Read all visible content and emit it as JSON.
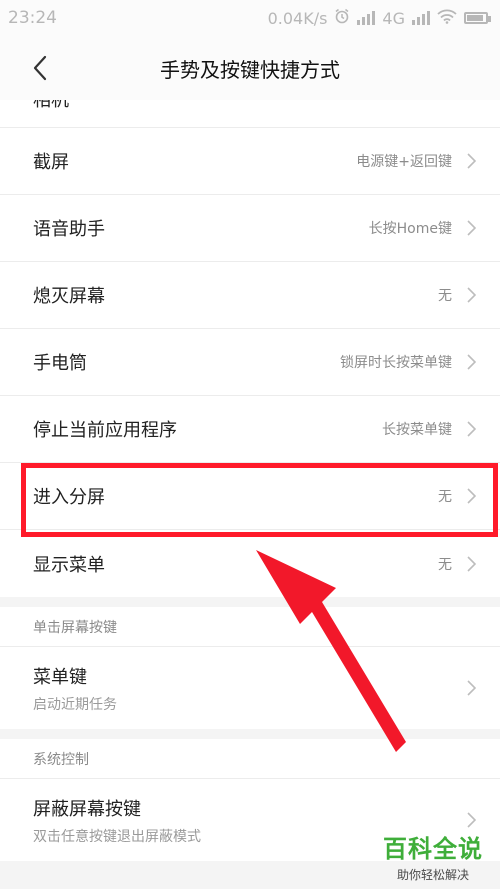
{
  "status_bar": {
    "time": "23:24",
    "speed": "0.04K/s",
    "network": "4G"
  },
  "header": {
    "title": "手势及按键快捷方式"
  },
  "gesture_rows": [
    {
      "label": "截屏",
      "value": "电源键+返回键"
    },
    {
      "label": "语音助手",
      "value": "长按Home键"
    },
    {
      "label": "熄灭屏幕",
      "value": "无"
    },
    {
      "label": "手电筒",
      "value": "锁屏时长按菜单键"
    },
    {
      "label": "停止当前应用程序",
      "value": "长按菜单键"
    },
    {
      "label": "进入分屏",
      "value": "无"
    },
    {
      "label": "显示菜单",
      "value": "无"
    }
  ],
  "partial_row_label": "相机",
  "section_single_tap": {
    "header": "单击屏幕按键",
    "row": {
      "label": "菜单键",
      "sub": "启动近期任务"
    }
  },
  "section_system": {
    "header": "系统控制",
    "row": {
      "label": "屏蔽屏幕按键",
      "sub": "双击任意按键退出屏蔽模式"
    }
  },
  "watermark": {
    "title": "百科全说",
    "subtitle": "助你轻松解决"
  },
  "colors": {
    "highlight": "#ff1a2a",
    "watermark": "#3fae3a"
  }
}
